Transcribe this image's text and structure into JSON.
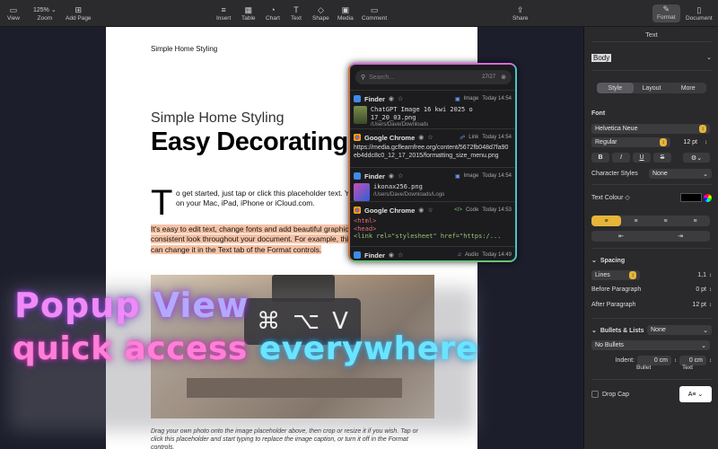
{
  "toolbar": {
    "items": [
      {
        "label": "View",
        "icon": "▭"
      },
      {
        "label": "Zoom",
        "icon": "125% ⌄"
      },
      {
        "label": "Add Page",
        "icon": "⊞"
      },
      {
        "label": "Insert",
        "icon": "≡"
      },
      {
        "label": "Table",
        "icon": "▦"
      },
      {
        "label": "Chart",
        "icon": "◔"
      },
      {
        "label": "Text",
        "icon": "T"
      },
      {
        "label": "Shape",
        "icon": "◇"
      },
      {
        "label": "Media",
        "icon": "▣"
      },
      {
        "label": "Comment",
        "icon": "▭"
      },
      {
        "label": "Share",
        "icon": "⇪"
      },
      {
        "label": "Format",
        "icon": "✎"
      },
      {
        "label": "Document",
        "icon": "▯"
      }
    ]
  },
  "doc": {
    "header": "Simple Home Styling",
    "subtitle": "Simple Home Styling",
    "title": "Easy Decorating",
    "dropcap": "T",
    "para1": "o get started, just tap or click this placeholder text. You can view and edit this document on your Mac, iPad, iPhone or iCloud.com.",
    "para2": "It's easy to edit text, change fonts and add beautiful graphics. Use paragraph styles to get a consistent look throughout your document. For example, this paragraph uses Body style. You can change it in the Text tab of the Format controls.",
    "caption": "Drag your own photo onto the image placeholder above, then crop or resize it if you wish. Tap or click this placeholder and start typing to replace the image caption, or turn it off in the Format controls."
  },
  "promo": {
    "shortcut": [
      "⌘",
      "⌥",
      "V"
    ],
    "line1_a": "Popup",
    "line1_b": "View",
    "line2_a": "quick access",
    "line2_b": "everywhere"
  },
  "popup": {
    "search_placeholder": "Search...",
    "count": "27/27",
    "entries": [
      {
        "app": "Finder",
        "type": "Image",
        "time": "Today 14:54",
        "line1": "ChatGPT Image 16 kwi 2025 o 17_20_03.png",
        "path": "/Users/Dave/Downloads"
      },
      {
        "app": "Google Chrome",
        "type": "Link",
        "time": "Today 14:54",
        "line1": "https://media.gcflearnfree.org/content/5672fb048d7fa90eb4ddc8c0_12_17_2015/formatting_size_menu.png"
      },
      {
        "app": "Finder",
        "type": "Image",
        "time": "Today 14:54",
        "line1": "ikonax256.png",
        "path": "/Users/Dave/Downloads/Logo"
      },
      {
        "app": "Google Chrome",
        "type": "Code",
        "time": "Today 14:53",
        "code": [
          "<html>",
          "<head>",
          "<link rel=\"stylesheet\" href=\"https:/..."
        ]
      },
      {
        "app": "Finder",
        "type": "Audio",
        "time": "Today 14:49"
      }
    ]
  },
  "inspector": {
    "title": "Text",
    "style_name": "Body",
    "tabs": [
      "Style",
      "Layout",
      "More"
    ],
    "font_label": "Font",
    "font_family": "Helvetica Neue",
    "font_style": "Regular",
    "font_size": "12 pt",
    "char_styles_label": "Character Styles",
    "char_styles_value": "None",
    "text_colour_label": "Text Colour ◇",
    "spacing_label": "Spacing",
    "spacing_mode": "Lines",
    "spacing_value": "1,1",
    "before_label": "Before Paragraph",
    "before_value": "0 pt",
    "after_label": "After Paragraph",
    "after_value": "12 pt",
    "bullets_label": "Bullets & Lists",
    "bullets_value": "None",
    "bullets_type": "No Bullets",
    "indent_label": "Indent:",
    "indent_bullet": "0 cm",
    "indent_text": "0 cm",
    "bullet_sub": "Bullet",
    "text_sub": "Text",
    "dropcap_label": "Drop Cap"
  }
}
